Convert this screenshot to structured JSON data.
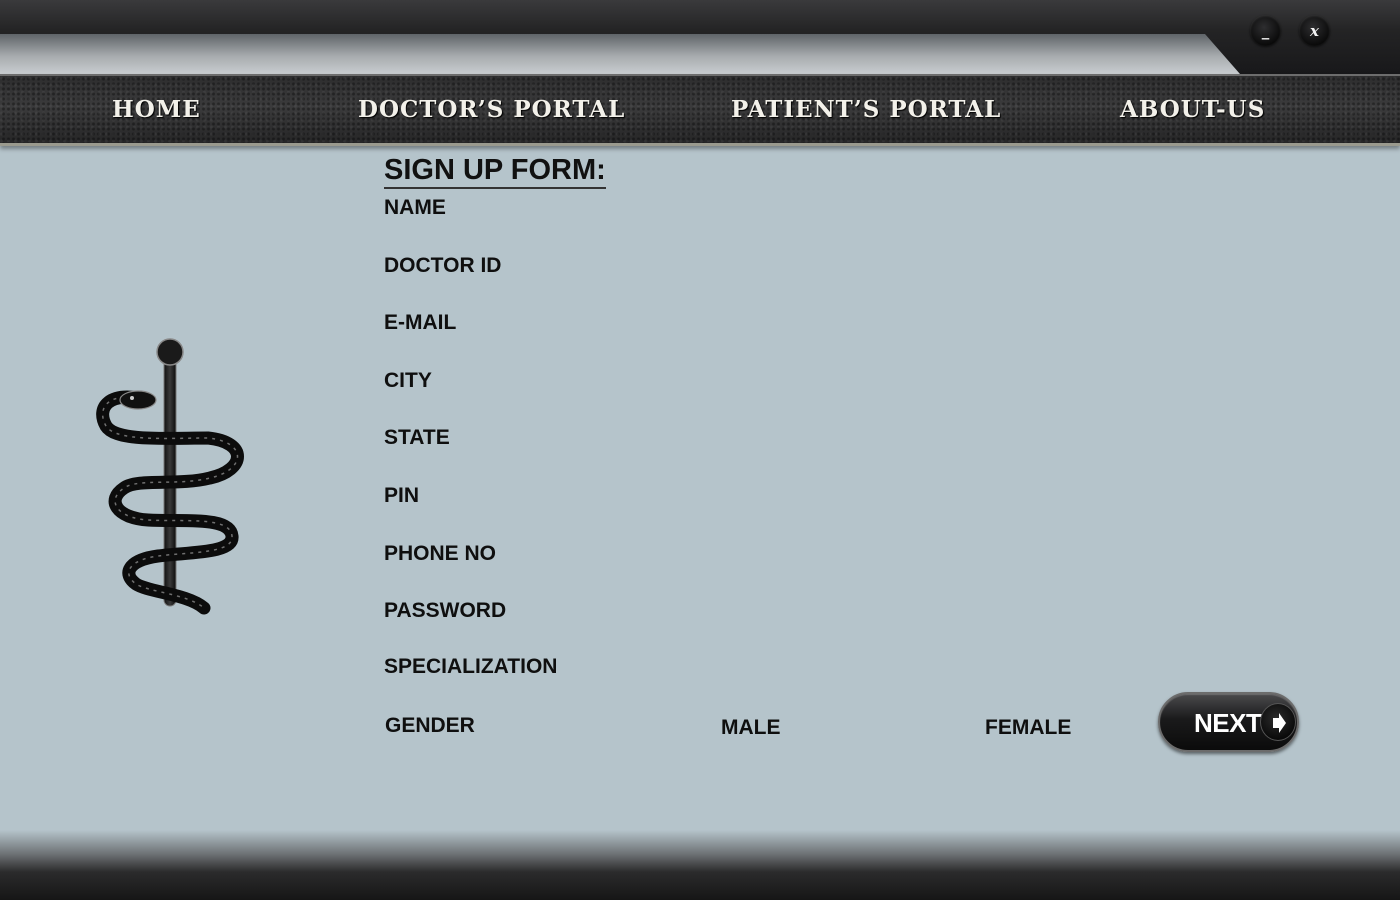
{
  "window": {
    "minimize_label": "_",
    "close_label": "x"
  },
  "nav": {
    "items": [
      {
        "label": "HOME"
      },
      {
        "label": "DOCTOR’S PORTAL"
      },
      {
        "label": "PATIENT’S PORTAL"
      },
      {
        "label": "ABOUT-US"
      }
    ]
  },
  "form": {
    "title": "SIGN UP FORM:",
    "fields": [
      {
        "label": "NAME"
      },
      {
        "label": "DOCTOR ID"
      },
      {
        "label": "E-MAIL"
      },
      {
        "label": "CITY"
      },
      {
        "label": "STATE"
      },
      {
        "label": "PIN"
      },
      {
        "label": "PHONE NO"
      },
      {
        "label": "PASSWORD"
      },
      {
        "label": "SPECIALIZATION"
      }
    ],
    "gender": {
      "label": "GENDER",
      "options": [
        "MALE",
        "FEMALE"
      ]
    },
    "next_label": "NEXT"
  },
  "icons": {
    "logo": "rod-of-asclepius-icon",
    "next": "arrow-right-icon"
  }
}
